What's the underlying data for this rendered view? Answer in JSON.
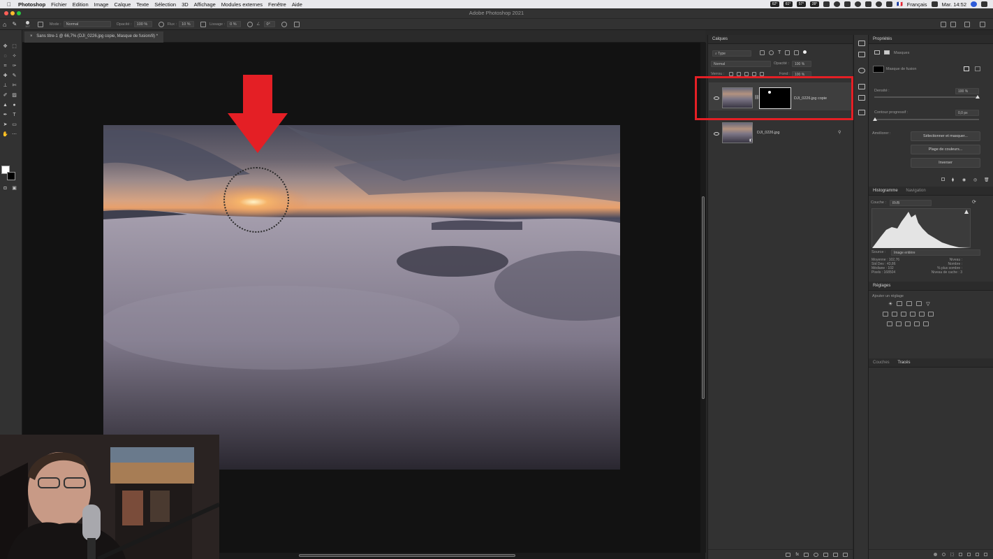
{
  "menubar": {
    "items": [
      "Photoshop",
      "Fichier",
      "Edition",
      "Image",
      "Calque",
      "Texte",
      "Sélection",
      "3D",
      "Affichage",
      "Modules externes",
      "Fenêtre",
      "Aide"
    ],
    "tray": {
      "temp1": "62°",
      "temp2": "61°",
      "temp3": "57°",
      "temp4": "28°",
      "language": "Français",
      "datetime": "Mar. 14:52"
    }
  },
  "window": {
    "title": "Adobe Photoshop 2021"
  },
  "options_bar": {
    "brush_size": "167",
    "mode_label": "Mode :",
    "mode_value": "Normal",
    "opacity_label": "Opacité :",
    "opacity_value": "100 %",
    "flow_label": "Flux :",
    "flow_value": "10 %",
    "smoothing_label": "Lissage :",
    "smoothing_value": "0 %",
    "angle_value": "0°"
  },
  "document": {
    "tab_title": "Sans titre-1 @ 66,7% (DJI_0226.jpg copie, Masque de fusion/8) *"
  },
  "layers_panel": {
    "title": "Calques",
    "filter_kind": "Type",
    "blend_mode": "Normal",
    "opacity_label": "Opacité :",
    "opacity_value": "100 %",
    "lock_label": "Verrou :",
    "fill_label": "Fond :",
    "fill_value": "100 %",
    "layers": [
      {
        "name": "DJI_0226.jpg copie",
        "selected": true,
        "has_mask": true
      },
      {
        "name": "DJI_0226.jpg",
        "selected": false,
        "has_mask": false
      }
    ]
  },
  "properties_panel": {
    "title": "Propriétés",
    "section": "Masques",
    "mask_type": "Masque de fusion",
    "density_label": "Densité :",
    "density_value": "100 %",
    "feather_label": "Contour progressif :",
    "feather_value": "0,0 px",
    "refine_label": "Améliorer :",
    "buttons": [
      "Sélectionner et masquer...",
      "Plage de couleurs...",
      "Inverser"
    ]
  },
  "histogram_panel": {
    "tabs": [
      "Histogramme",
      "Navigation"
    ],
    "channel_label": "Couche :",
    "channel_value": "RVB",
    "source_label": "Source :",
    "source_value": "Image entière",
    "stats": {
      "mean_label": "Moyenne :",
      "mean_value": "102,76",
      "stddev_label": "Std Dev :",
      "stddev_value": "43,86",
      "median_label": "Médiane :",
      "median_value": "102",
      "pixels_label": "Pixels :",
      "pixels_value": "168504",
      "level_label": "Niveau :",
      "count_label": "Nombre :",
      "percentile_label": "% plus sombre :",
      "cache_label": "Niveau de cache :",
      "cache_value": "3"
    }
  },
  "adjustments_panel": {
    "title": "Réglages",
    "subtitle": "Ajouter un réglage"
  },
  "bottom_panel": {
    "tabs": [
      "Couches",
      "Tracés"
    ]
  },
  "colors": {
    "accent_red": "#e41f25",
    "panel_bg": "#323232",
    "canvas_bg": "#121212"
  }
}
